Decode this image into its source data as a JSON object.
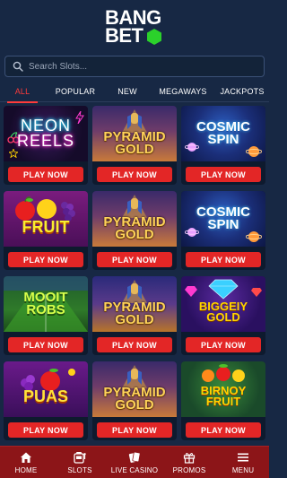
{
  "brand": {
    "line1": "BANG",
    "line2": "BET",
    "accent_color": "#2bd12b"
  },
  "search": {
    "placeholder": "Search Slots..."
  },
  "tabs": [
    {
      "label": "ALL",
      "active": true
    },
    {
      "label": "POPULAR",
      "active": false
    },
    {
      "label": "NEW",
      "active": false
    },
    {
      "label": "MEGAWAYS",
      "active": false
    },
    {
      "label": "JACKPOTS",
      "active": false
    }
  ],
  "games": [
    {
      "title_line1": "NEON",
      "title_line2": "REELS",
      "theme": "neon",
      "button": "PLAY NOW"
    },
    {
      "title_line1": "PYRAMID",
      "title_line2": "GOLD",
      "theme": "pyramid",
      "button": "PLAY NOW"
    },
    {
      "title_line1": "COSMIC",
      "title_line2": "SPIN",
      "theme": "cosmic",
      "button": "PLAY NOW"
    },
    {
      "title_line1": "FRUIT",
      "title_line2": "",
      "theme": "fruit",
      "button": "PLAY NOW"
    },
    {
      "title_line1": "PYRAMID",
      "title_line2": "GOLD",
      "theme": "pyramid",
      "button": "PLAY NOW"
    },
    {
      "title_line1": "COSMIC",
      "title_line2": "SPIN",
      "theme": "cosmic",
      "button": "PLAY NOW"
    },
    {
      "title_line1": "MOOIT",
      "title_line2": "ROBS",
      "theme": "mooit",
      "button": "PLAY NOW"
    },
    {
      "title_line1": "PYRAMID",
      "title_line2": "GOLD",
      "theme": "pyramid",
      "button": "PLAY NOW"
    },
    {
      "title_line1": "BIGGEIY",
      "title_line2": "GOLD",
      "theme": "biggey",
      "button": "PLAY NOW"
    },
    {
      "title_line1": "PUAS",
      "title_line2": "",
      "theme": "puas",
      "button": "PLAY NOW"
    },
    {
      "title_line1": "PYRAMID",
      "title_line2": "GOLD",
      "theme": "pyramid",
      "button": "PLAY NOW"
    },
    {
      "title_line1": "BIRNOY",
      "title_line2": "FRUIT",
      "theme": "birnoy",
      "button": "PLAY NOW"
    }
  ],
  "bottom_nav": [
    {
      "label": "HOME",
      "icon": "home-icon"
    },
    {
      "label": "SLOTS",
      "icon": "slot-machine-icon"
    },
    {
      "label": "LIVE CASINO",
      "icon": "playing-cards-icon"
    },
    {
      "label": "PROMOS",
      "icon": "gift-icon"
    },
    {
      "label": "MENU",
      "icon": "hamburger-menu-icon"
    }
  ],
  "colors": {
    "background": "#172844",
    "primary_red": "#e32626",
    "nav_red": "#8c1518",
    "active_tab": "#ff3b3b"
  }
}
